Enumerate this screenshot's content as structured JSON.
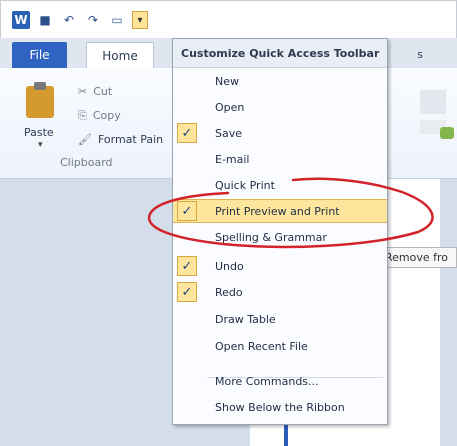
{
  "qat": {
    "icons": [
      "word-icon",
      "save-icon",
      "undo-icon",
      "redo-icon",
      "print-preview-icon",
      "customize-qat-icon"
    ]
  },
  "tabs": {
    "file": "File",
    "home": "Home",
    "right_cut": "s"
  },
  "ribbon": {
    "paste": "Paste",
    "cut": "Cut",
    "copy": "Copy",
    "format_painter": "Format Pain",
    "group_label": "Clipboard"
  },
  "menu": {
    "title": "Customize Quick Access Toolbar",
    "items": [
      {
        "label": "New",
        "checked": false
      },
      {
        "label": "Open",
        "checked": false
      },
      {
        "label": "Save",
        "checked": true
      },
      {
        "label": "E-mail",
        "checked": false
      },
      {
        "label": "Quick Print",
        "checked": false
      },
      {
        "label": "Print Preview and Print",
        "checked": true,
        "highlighted": true
      },
      {
        "label": "Spelling & Grammar",
        "checked": false
      },
      {
        "label": "Undo",
        "checked": true
      },
      {
        "label": "Redo",
        "checked": true
      },
      {
        "label": "Draw Table",
        "checked": false
      },
      {
        "label": "Open Recent File",
        "checked": false
      },
      {
        "label": "More Commands...",
        "checked": false
      },
      {
        "label": "Show Below the Ribbon",
        "checked": false
      }
    ]
  },
  "tooltip": "Remove fro",
  "colors": {
    "annotation": "#d2232a",
    "highlight": "#fde69b",
    "file_tab": "#2f64c3"
  }
}
